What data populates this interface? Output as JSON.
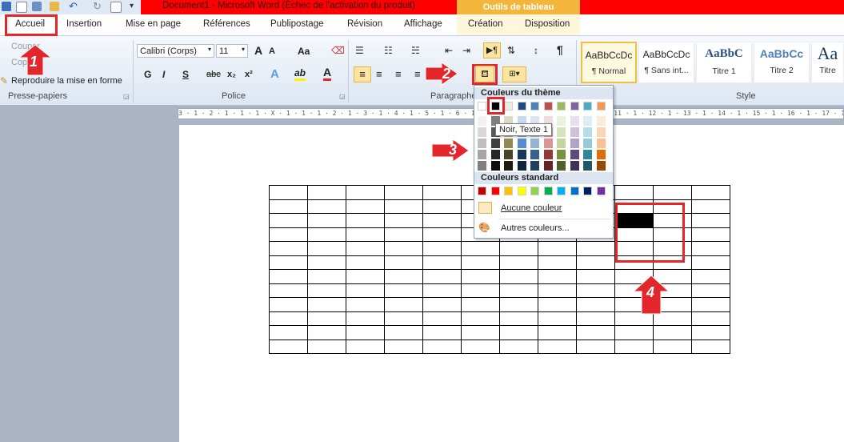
{
  "window": {
    "title": "Document1  -  Microsoft Word (Échec de l'activation du produit)",
    "context_group": "Outils de tableau"
  },
  "tabs": [
    {
      "label": "Accueil"
    },
    {
      "label": "Insertion"
    },
    {
      "label": "Mise en page"
    },
    {
      "label": "Références"
    },
    {
      "label": "Publipostage"
    },
    {
      "label": "Révision"
    },
    {
      "label": "Affichage"
    },
    {
      "label": "Création"
    },
    {
      "label": "Disposition"
    }
  ],
  "clipboard": {
    "cut_label": "Couper",
    "copy_label": "Copier",
    "format_painter_label": "Reproduire la mise en forme",
    "group_label": "Presse-papiers"
  },
  "font": {
    "font_name": "Calibri (Corps)",
    "font_size": "11",
    "bold": "G",
    "italic": "I",
    "underline": "S",
    "strikethrough": "abc",
    "subscript": "x₂",
    "superscript": "x²",
    "grow": "A",
    "shrink": "A",
    "change_case": "Aa",
    "text_effect": "A",
    "highlight": "ab",
    "font_color": "A",
    "group_label": "Police"
  },
  "paragraph": {
    "group_label": "Paragraphe",
    "pilcrow": "¶"
  },
  "styles": {
    "group_label": "Style",
    "items": [
      {
        "preview": "AaBbCcDc",
        "name": "¶ Normal"
      },
      {
        "preview": "AaBbCcDc",
        "name": "¶ Sans int..."
      },
      {
        "preview": "AaBbC",
        "name": "Titre 1"
      },
      {
        "preview": "AaBbCc",
        "name": "Titre 2"
      },
      {
        "preview": "Aa",
        "name": "Titre"
      }
    ]
  },
  "ruler": {
    "text": "3 · 1 · 2 · 1 · 1 · 1 · X · 1 · 1 · 1 · 2 · 1 · 3 · 1 · 4 · 1 · 5 · 1 · 6 · 1 · 7 · 1 · 8 · 1 · 9 · 1 · 10 · 1 · 11 · 1 · 12 · 1 · 13 · 1 · 14 · 1 · 15 · 1 · 16 · 1 · 17 · 1 · 18"
  },
  "shading_menu": {
    "theme_header": "Couleurs du thème",
    "standard_header": "Couleurs standard",
    "no_color": "Aucune couleur",
    "more_colors": "Autres couleurs...",
    "tooltip": "Noir, Texte 1",
    "theme_rows": [
      [
        "#ffffff",
        "#000000",
        "#eeece1",
        "#1f497d",
        "#4f81bd",
        "#c0504d",
        "#9bbb59",
        "#8064a2",
        "#4bacc6",
        "#f79646"
      ],
      [
        "#f2f2f2",
        "#7f7f7f",
        "#ddd9c3",
        "#c6d9f0",
        "#dbe5f1",
        "#f2dcdb",
        "#ebf1dd",
        "#e5e0ec",
        "#dbeef3",
        "#fdeada"
      ],
      [
        "#d8d8d8",
        "#595959",
        "#c4bd97",
        "#8db3e2",
        "#b8cce4",
        "#e5b9b7",
        "#d7e3bc",
        "#ccc1d9",
        "#b7dde8",
        "#fbd5b5"
      ],
      [
        "#bfbfbf",
        "#3f3f3f",
        "#938953",
        "#548dd4",
        "#95b3d7",
        "#d99694",
        "#c3d69b",
        "#b2a2c7",
        "#92cddc",
        "#fac08f"
      ],
      [
        "#a5a5a5",
        "#262626",
        "#494429",
        "#17365d",
        "#366092",
        "#953734",
        "#76923c",
        "#5f497a",
        "#31859b",
        "#e36c09"
      ],
      [
        "#7f7f7f",
        "#0c0c0c",
        "#1d1b10",
        "#0f243e",
        "#244061",
        "#632423",
        "#4f6128",
        "#3f3151",
        "#205867",
        "#974806"
      ]
    ],
    "standard_row": [
      "#c00000",
      "#ff0000",
      "#ffc000",
      "#ffff00",
      "#92d050",
      "#00b050",
      "#00b0f0",
      "#0070c0",
      "#002060",
      "#7030a0"
    ]
  },
  "annotations": {
    "step1": "1",
    "step2": "2",
    "step3": "3",
    "step4": "4",
    "color": "#e3262b"
  },
  "table": {
    "rows": 12,
    "cols": 12,
    "filled_cell": {
      "row": 2,
      "col": 9,
      "color": "#000000"
    }
  }
}
